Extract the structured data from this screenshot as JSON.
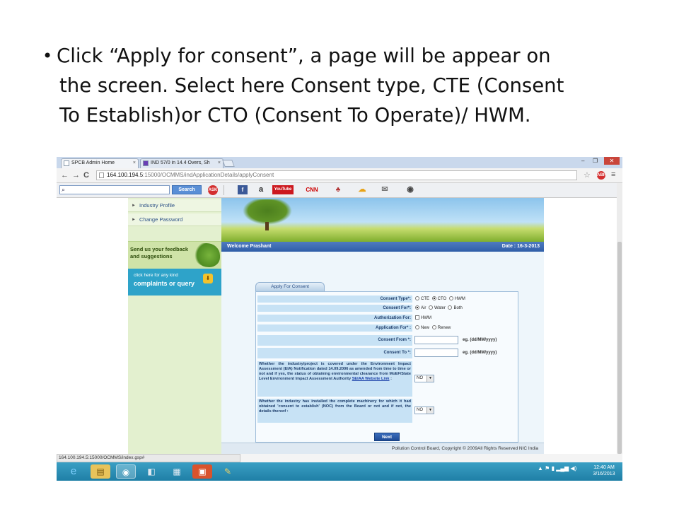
{
  "slide": {
    "bullet": "•",
    "lines": [
      "Click “Apply for consent”, a page will be  appear on",
      "the screen. Select here Consent  type, CTE (Consent",
      "To Establish)or CTO (Consent To Operate)/ HWM."
    ]
  },
  "browser": {
    "tabs": [
      {
        "title": "SPCB Admin Home",
        "close": "×"
      },
      {
        "title": "IND 57/0 in 14.4 Overs, Sh",
        "close": "×"
      }
    ],
    "window_controls": {
      "minimize": "–",
      "restore": "❐",
      "close": "✕"
    },
    "nav": {
      "back": "←",
      "forward": "→",
      "reload": "C"
    },
    "address": {
      "host": "164.100.194.5",
      "path": ":15000/OCMMS/indApplicationDetails/applyConsent"
    },
    "star": "☆",
    "adblock": "ABP",
    "menu": "≡",
    "search_button": "Search",
    "ask_label": "ASK",
    "toolbar_icons": [
      {
        "name": "facebook-icon",
        "label": "f",
        "color": "#3b5998"
      },
      {
        "name": "amazon-icon",
        "label": "a",
        "color": "#222222"
      },
      {
        "name": "youtube-icon",
        "label": "YouTube",
        "color": "#cc181e"
      },
      {
        "name": "cnn-icon",
        "label": "CNN",
        "color": "#cc0000"
      },
      {
        "name": "game-icon",
        "label": "♣",
        "color": "#b03030"
      },
      {
        "name": "weather-icon",
        "label": "☁",
        "color": "#e8a317"
      },
      {
        "name": "mail-icon",
        "label": "✉",
        "color": "#777777"
      },
      {
        "name": "radio-icon",
        "label": "◉",
        "color": "#444444"
      }
    ],
    "status_url": "164.100.194.5:15000/OCMMS/index.gsp#"
  },
  "page": {
    "nav_links": [
      "Industry Profile",
      "Change Password"
    ],
    "feedback": {
      "line1": "Send us your feedback",
      "line2": "and suggestions"
    },
    "complaint": {
      "line1": "click here for any kind",
      "line2": "complaints or query"
    },
    "welcome": "Welcome Prashant",
    "date": "Date : 16-3-2013",
    "footer": "Pollution Control Board, Copyright © 2009All Rights Reserved NIC India"
  },
  "form": {
    "tab": "Apply For Consent",
    "consent_type": {
      "label": "Consent Type*:",
      "options": [
        "CTE",
        "CTO",
        "HWM"
      ],
      "selected": "CTO"
    },
    "consent_for": {
      "label": "Consent For*:",
      "options": [
        "Air",
        "Water",
        "Both"
      ],
      "selected": "Air"
    },
    "authorization_for": {
      "label": "Authorization For:",
      "option": "HWM"
    },
    "application_for": {
      "label": "Application For* :",
      "options": [
        "New",
        "Renew"
      ]
    },
    "consent_from": {
      "label": "Consent From *:",
      "hint": "eg. (dd/MM/yyyy)"
    },
    "consent_to": {
      "label": "Consent To *:",
      "hint": "eg. (dd/MM/yyyy)"
    },
    "eia_question": {
      "text": "Whether the industry/project is covered under the Environment Impact Assessment (EIA) Notification dated 14.09.2006 as amended from time to time or not and if yes, the status of obtaining environmental clearance from MoEF/State Level Environment Impact Assessment Authority",
      "link": "SEIAA Website Link",
      "after_link": " :",
      "value": "NO"
    },
    "noc_question": {
      "text": "Whether the industry has installed the complete machinery for which it had obtained 'consent to establish' (NOC) from the Board or not and if not, the details thereof :",
      "value": "NO"
    },
    "next_button": "Next"
  },
  "taskbar": {
    "time": "12:40 AM",
    "date": "3/16/2013"
  }
}
